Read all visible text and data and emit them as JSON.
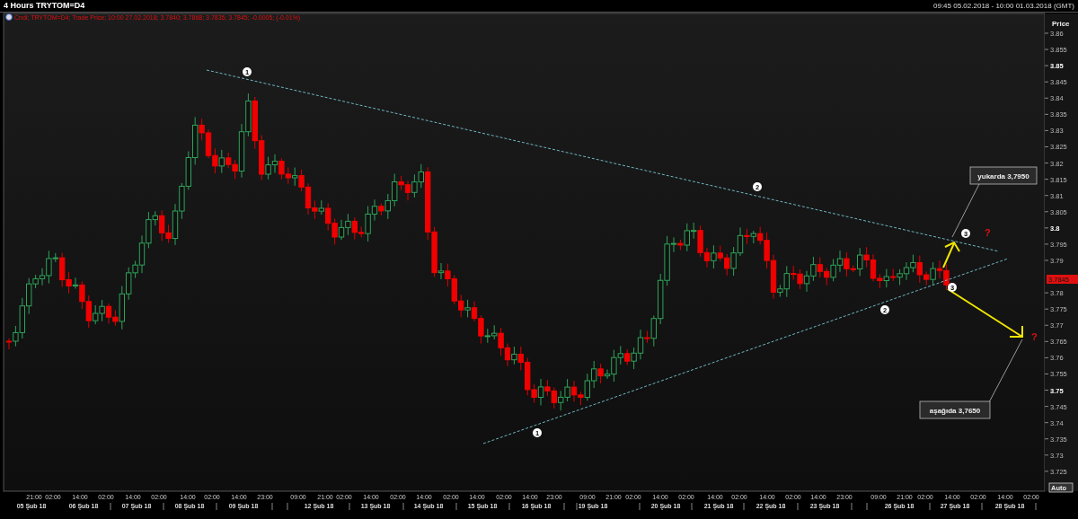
{
  "window": {
    "title": "4 Hours TRYTOM=D4",
    "range": "09:45 05.02.2018 - 10:00 01.03.2018 (GMT)"
  },
  "legend": {
    "text": "Cndl; TRYTOM=D4; Trade Price; 10:00 27.02.2018; 3.7840; 3.7868; 3.7835; 3.7845; -0.0005; (-0.01%)"
  },
  "price_axis": {
    "title": "Price",
    "current_price": "3.7845",
    "auto_button": "Auto",
    "ticks": [
      {
        "label": "3.86",
        "bold": false
      },
      {
        "label": "3.855",
        "bold": false
      },
      {
        "label": "3.85",
        "bold": true
      },
      {
        "label": "3.845",
        "bold": false
      },
      {
        "label": "3.84",
        "bold": false
      },
      {
        "label": "3.835",
        "bold": false
      },
      {
        "label": "3.83",
        "bold": false
      },
      {
        "label": "3.825",
        "bold": false
      },
      {
        "label": "3.82",
        "bold": false
      },
      {
        "label": "3.815",
        "bold": false
      },
      {
        "label": "3.81",
        "bold": false
      },
      {
        "label": "3.805",
        "bold": false
      },
      {
        "label": "3.8",
        "bold": true
      },
      {
        "label": "3.795",
        "bold": false
      },
      {
        "label": "3.79",
        "bold": false
      },
      {
        "label": "3.78",
        "bold": false
      },
      {
        "label": "3.775",
        "bold": false
      },
      {
        "label": "3.77",
        "bold": false
      },
      {
        "label": "3.765",
        "bold": false
      },
      {
        "label": "3.76",
        "bold": false
      },
      {
        "label": "3.755",
        "bold": false
      },
      {
        "label": "3.75",
        "bold": true
      },
      {
        "label": "3.745",
        "bold": false
      },
      {
        "label": "3.74",
        "bold": false
      },
      {
        "label": "3.735",
        "bold": false
      },
      {
        "label": "3.73",
        "bold": false
      },
      {
        "label": "3.725",
        "bold": false
      }
    ]
  },
  "time_axis": {
    "times": [
      "21:00",
      "02:00",
      "14:00",
      "02:00",
      "14:00",
      "02:00",
      "14:00",
      "02:00",
      "14:00",
      "23:00",
      "09:00",
      "21:00",
      "02:00",
      "14:00",
      "02:00",
      "14:00",
      "02:00",
      "14:00",
      "02:00",
      "14:00",
      "23:00",
      "09:00",
      "21:00",
      "02:00",
      "14:00",
      "02:00",
      "14:00",
      "02:00",
      "14:00",
      "02:00",
      "14:00",
      "23:00",
      "09:00",
      "21:00",
      "02:00",
      "14:00",
      "02:00",
      "14:00",
      "02:00"
    ],
    "dates": [
      "05 Şub 18",
      "06 Şub 18",
      "07 Şub 18",
      "08 Şub 18",
      "09 Şub 18",
      "12 Şub 18",
      "13 Şub 18",
      "14 Şub 18",
      "15 Şub 18",
      "16 Şub 18",
      "19 Şub 18",
      "20 Şub 18",
      "21 Şub 18",
      "22 Şub 18",
      "23 Şub 18",
      "26 Şub 18",
      "27 Şub 18",
      "28 Şub 18"
    ]
  },
  "annotations": {
    "markers": [
      "1",
      "1",
      "2",
      "2",
      "3",
      "3"
    ],
    "question_marks": [
      "?",
      "?"
    ],
    "callouts": [
      "yukarda 3,7950",
      "aşağıda 3,7650"
    ]
  }
}
